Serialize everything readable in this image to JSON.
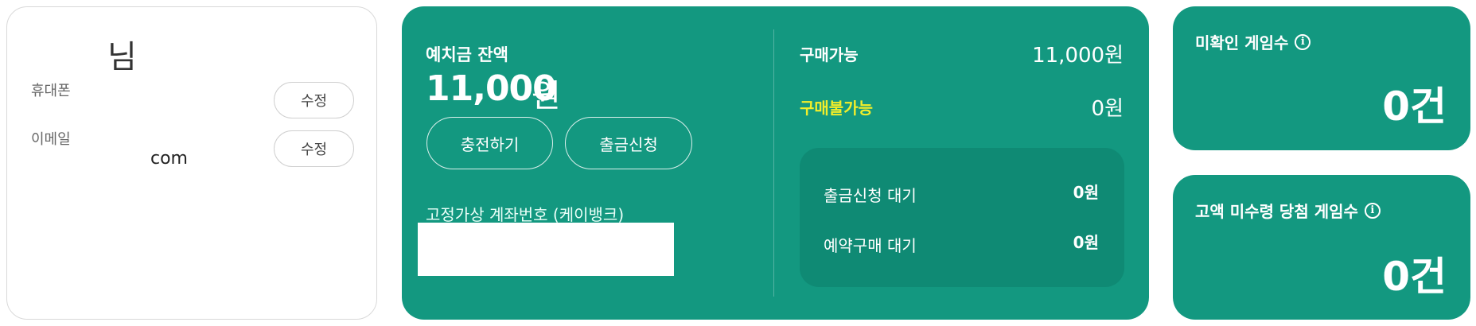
{
  "profile": {
    "name_suffix": "님",
    "phone_label": "휴대폰",
    "email_label": "이메일",
    "email_value": "com",
    "edit_label": "수정"
  },
  "wallet": {
    "balance_label": "예치금 잔액",
    "balance_value": "11,000",
    "balance_unit": "원",
    "charge_button": "충전하기",
    "withdraw_button": "출금신청",
    "account_label": "고정가상 계좌번호 (케이뱅크)",
    "purchasable_label": "구매가능",
    "purchasable_value": "11,000원",
    "not_purchasable_label": "구매불가능",
    "not_purchasable_value": "0원",
    "pending_withdraw_label": "출금신청 대기",
    "pending_withdraw_value": "0원",
    "pending_reserve_label": "예약구매 대기",
    "pending_reserve_value": "0원"
  },
  "counts": {
    "unconfirmed_label": "미확인 게임수",
    "unconfirmed_value": "0건",
    "unclaimed_label": "고액 미수령 당첨 게임수",
    "unclaimed_value": "0건",
    "info_glyph": "i"
  },
  "colors": {
    "accent_green": "#139880",
    "panel_green": "#0f8a74",
    "highlight_yellow": "#f2ee2a"
  }
}
